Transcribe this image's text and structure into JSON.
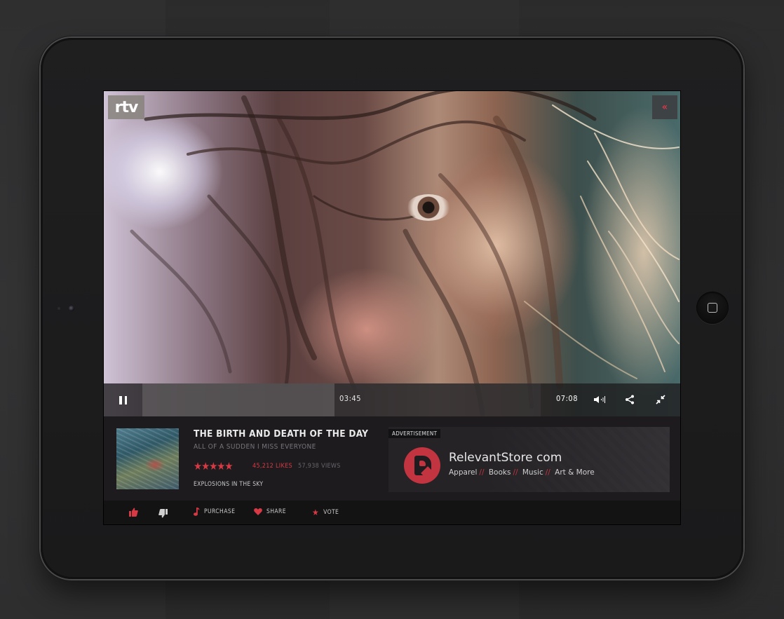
{
  "app": {
    "logo_text": "rtv"
  },
  "video": {
    "back_icon": "double-chevron-left-icon",
    "elapsed": "03:45",
    "total": "07:08",
    "progress_fraction": 0.483,
    "buffer_fraction": 0.0,
    "controls": {
      "pause_icon": "pause-icon",
      "volume_icon": "volume-icon",
      "share_icon": "share-icon",
      "minimize_icon": "minimize-icon"
    }
  },
  "track": {
    "title": "THE BIRTH AND DEATH OF THE DAY",
    "subtitle": "ALL OF A SUDDEN I MISS EVERYONE",
    "rating": 4.5,
    "stars": "★★★★★",
    "likes": "45,212 LIKES",
    "views": "57,938 VIEWS",
    "artist": "EXPLOSIONS IN THE SKY"
  },
  "ad": {
    "label": "ADVERTISEMENT",
    "title": "RelevantStore com",
    "categories": [
      "Apparel",
      "Books",
      "Music",
      "Art & More"
    ],
    "separator": "//"
  },
  "actions": {
    "like_icon": "thumbs-up-icon",
    "dislike_icon": "thumbs-down-icon",
    "purchase": "PURCHASE",
    "share": "SHARE",
    "vote": "VOTE"
  },
  "colors": {
    "accent": "#d83a45",
    "panel": "#1d1b1e",
    "bar": "#141314"
  }
}
